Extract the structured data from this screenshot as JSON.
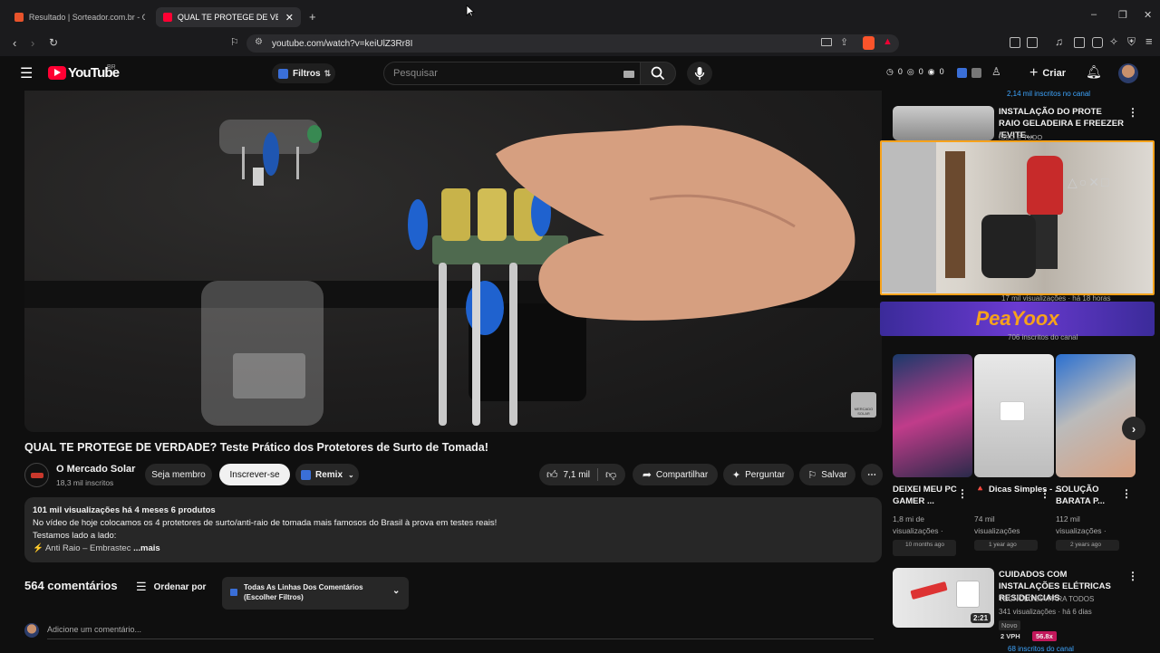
{
  "browser": {
    "tabs": [
      {
        "label": "Resultado | Sorteador.com.br - O Site"
      },
      {
        "label": "QUAL TE PROTEGE DE VERDADE"
      }
    ],
    "url": "youtube.com/watch?v=keiUlZ3Rr8I"
  },
  "header": {
    "logo": "YouTube",
    "logo_region": "BR",
    "filters_label": "Filtros",
    "search_placeholder": "Pesquisar",
    "counters": [
      "0",
      "0",
      "0"
    ],
    "create_label": "Criar"
  },
  "video": {
    "title": "QUAL TE PROTEGE DE VERDADE? Teste Prático dos Protetores de Surto de Tomada!",
    "watermark": "MERCADO SOLAR"
  },
  "channel": {
    "name": "O Mercado Solar",
    "subscribers": "18,3 mil inscritos",
    "member_label": "Seja membro",
    "subscribe_label": "Inscrever-se",
    "remix_label": "Remix"
  },
  "actions": {
    "likes": "7,1 mil",
    "share_label": "Compartilhar",
    "ask_label": "Perguntar",
    "save_label": "Salvar"
  },
  "description": {
    "stats": "101 mil visualizações  há 4 meses  6 produtos",
    "line1": "No vídeo de hoje colocamos os 4 protetores de surto/anti-raio de tomada mais famosos do Brasil à prova em testes reais!",
    "line2": "Testamos lado a lado:",
    "line3": "⚡ Anti Raio – Embrastec",
    "more": "...mais"
  },
  "comments": {
    "count": "564 comentários",
    "sort_label": "Ordenar por",
    "filter_label_1": "Todas As Linhas Dos Comentários",
    "filter_label_2": "(Escolher Filtros)",
    "add_placeholder": "Adicione um comentário..."
  },
  "sidebar": {
    "top_subs": "2,14 mil inscritos no canal",
    "rec1": {
      "title": "INSTALAÇÃO DO PROTE RAIO GELADEIRA E FREEZER /EVITE...",
      "meta": "ISSO É TUDO"
    },
    "webcam_meta": "17 mil visualizações · há 18 horas",
    "banner_text": "PeaYoox",
    "banner_sub": "706 inscritos do canal",
    "shorts": [
      {
        "title": "DEIXEI MEU PC GAMER ...",
        "views": "1,8 mi de",
        "views2": "visualizações ·",
        "age": "10 months ago"
      },
      {
        "title": "Dicas Simples - ...",
        "views": "74 mil",
        "views2": "visualizações",
        "age": "1 year ago",
        "badge": "🔺"
      },
      {
        "title": "SOLUÇÃO BARATA P...",
        "views": "112 mil",
        "views2": "visualizações ·",
        "age": "2 years ago"
      }
    ],
    "rec2": {
      "title": "CUIDADOS COM INSTALAÇÕES ELÉTRICAS RESIDENCIAIS",
      "channel": "TECNOLOGIA PARA TODOS",
      "meta": "341 visualizações · há 6 dias",
      "new_badge": "Novo",
      "duration": "2:21",
      "vph": "2 VPH",
      "ratio": "56.8x",
      "subs": "68 inscritos do canal"
    }
  }
}
